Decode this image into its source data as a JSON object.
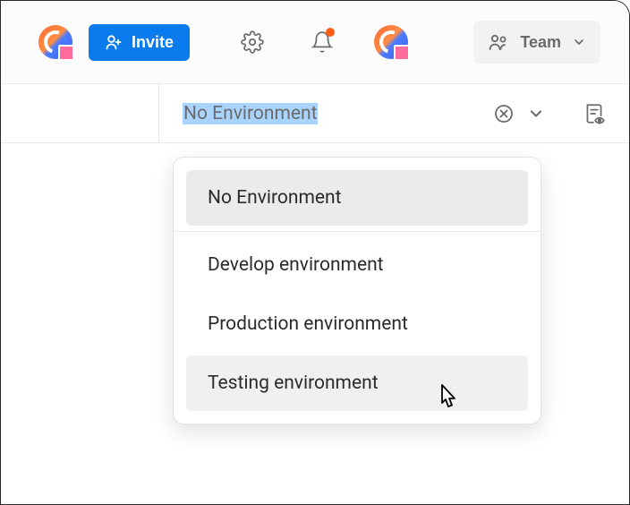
{
  "header": {
    "invite_label": "Invite",
    "team_label": "Team"
  },
  "environment": {
    "selected": "No Environment",
    "options": [
      {
        "label": "No Environment",
        "selected": true,
        "hover": false
      },
      {
        "label": "Develop environment",
        "selected": false,
        "hover": false
      },
      {
        "label": "Production environment",
        "selected": false,
        "hover": false
      },
      {
        "label": "Testing environment",
        "selected": false,
        "hover": true
      }
    ]
  }
}
